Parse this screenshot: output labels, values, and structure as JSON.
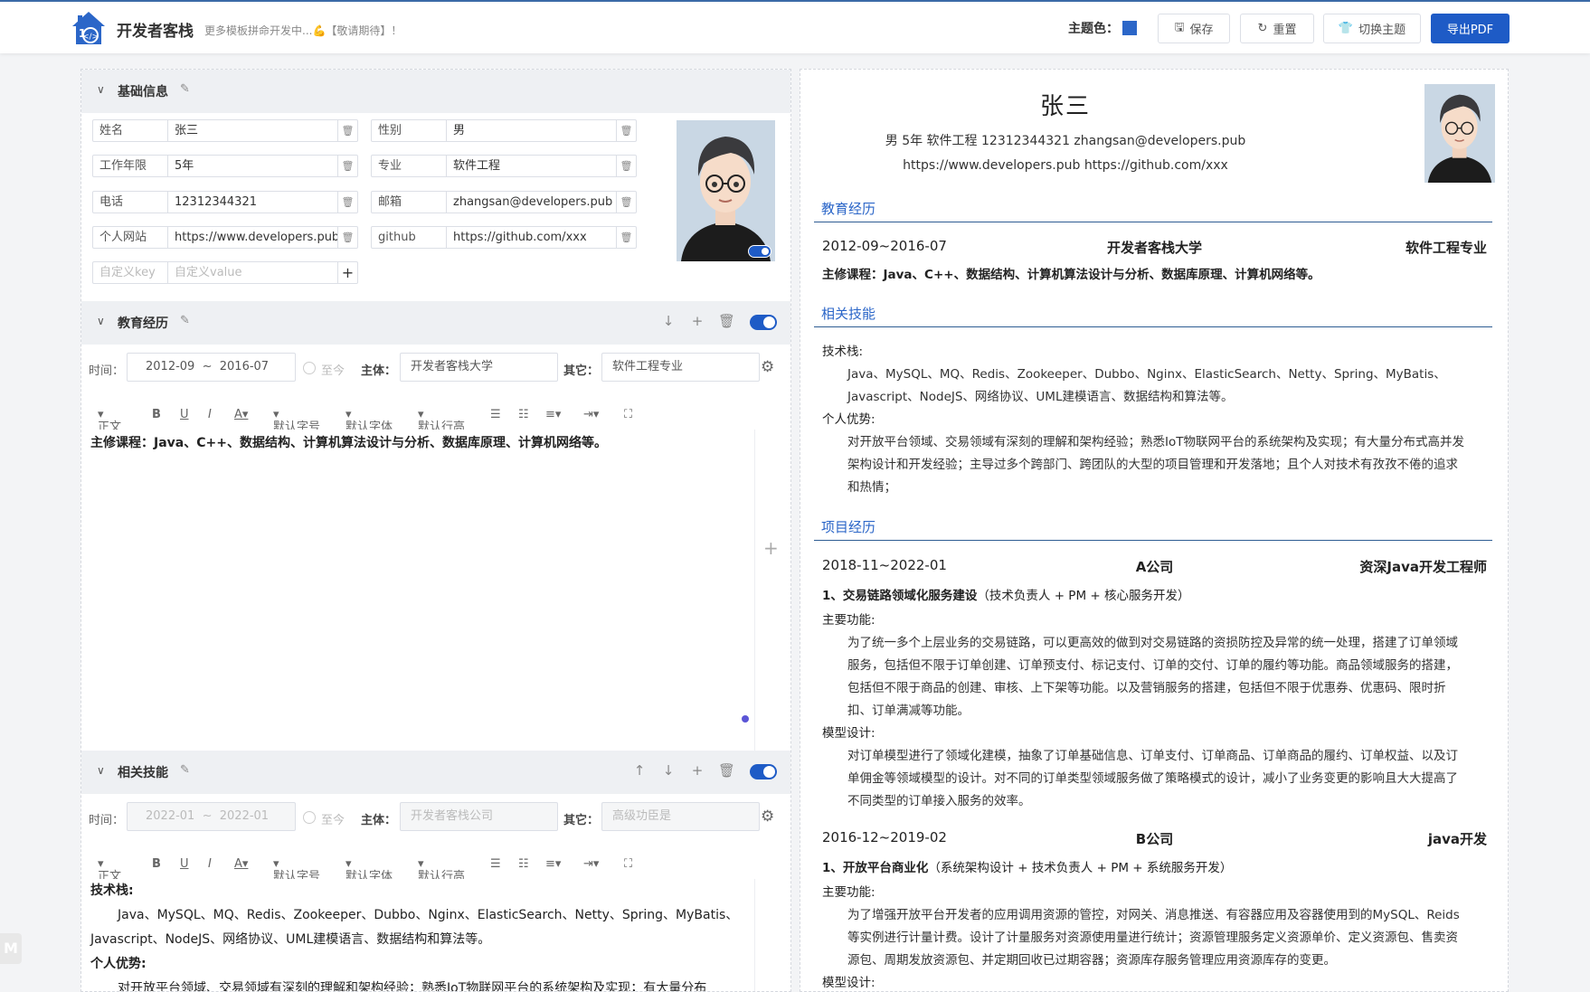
{
  "header": {
    "brand": "开发者客栈",
    "subtitle": "更多模板拼命开发中...💪【敬请期待】！",
    "theme_label": "主题色：",
    "theme_color": "#2b66c8",
    "buttons": {
      "save": "保存",
      "reset": "重置",
      "switch_theme": "切换主题",
      "export": "导出PDF"
    }
  },
  "basic": {
    "title": "基础信息",
    "fields": [
      {
        "key": "姓名",
        "value": "张三"
      },
      {
        "key": "性别",
        "value": "男"
      },
      {
        "key": "工作年限",
        "value": "5年"
      },
      {
        "key": "专业",
        "value": "软件工程"
      },
      {
        "key": "电话",
        "value": "12312344321"
      },
      {
        "key": "邮箱",
        "value": "zhangsan@developers.pub"
      },
      {
        "key": "个人网站",
        "value": "https://www.developers.pub"
      },
      {
        "key": "github",
        "value": "https://github.com/xxx"
      }
    ],
    "custom_key_placeholder": "自定义key",
    "custom_value_placeholder": "自定义value"
  },
  "education": {
    "title": "教育经历",
    "time_label": "时间：",
    "start": "2012-09",
    "sep": "~",
    "end": "2016-07",
    "until_now": "至今",
    "subject_label": "主体：",
    "subject": "开发者客栈大学",
    "other_label": "其它：",
    "other": "软件工程专业",
    "content_prefix": "主修课程：",
    "content": "Java、C++、数据结构、计算机算法设计与分析、数据库原理、计算机网络等。"
  },
  "skills": {
    "title": "相关技能",
    "time_label": "时间：",
    "start_ph": "2022-01",
    "sep": "~",
    "end_ph": "2022-01",
    "until_now": "至今",
    "subject_label": "主体：",
    "subject_ph": "开发者客栈公司",
    "other_label": "其它：",
    "other_ph": "高级功臣是",
    "stack_label": "技术栈:",
    "stack_line1": "Java、MySQL、MQ、Redis、Zookeeper、Dubbo、Nginx、ElasticSearch、Netty、Spring、MyBatis、",
    "stack_line2": "Javascript、NodeJS、网络协议、UML建模语言、数据结构和算法等。",
    "adv_label": "个人优势:",
    "adv_line1": "对开放平台领域、交易领域有深刻的理解和架构经验；熟悉IoT物联网平台的系统架构及实现；有大量分布"
  },
  "toolbar": {
    "style": "正文",
    "size": "默认字号",
    "font": "默认字体",
    "line": "默认行高"
  },
  "preview": {
    "name": "张三",
    "info_line1": "男  5年  软件工程  12312344321  zhangsan@developers.pub",
    "info_line2": "https://www.developers.pub  https://github.com/xxx",
    "edu_title": "教育经历",
    "edu_date": "2012-09~2016-07",
    "edu_school": "开发者客栈大学",
    "edu_major": "软件工程专业",
    "edu_course": "主修课程：Java、C++、数据结构、计算机算法设计与分析、数据库原理、计算机网络等。",
    "skill_title": "相关技能",
    "skill_stack_label": "技术栈:",
    "skill_stack_1": "Java、MySQL、MQ、Redis、Zookeeper、Dubbo、Nginx、ElasticSearch、Netty、Spring、MyBatis、",
    "skill_stack_2": "Javascript、NodeJS、网络协议、UML建模语言、数据结构和算法等。",
    "skill_adv_label": "个人优势:",
    "skill_adv_1": "对开放平台领域、交易领域有深刻的理解和架构经验；熟悉IoT物联网平台的系统架构及实现；有大量分布式高并发",
    "skill_adv_2": "架构设计和开发经验；主导过多个跨部门、跨团队的大型的项目管理和开发落地；且个人对技术有孜孜不倦的追求",
    "skill_adv_3": "和热情；",
    "proj_title": "项目经历",
    "proj_a_date": "2018-11~2022-01",
    "proj_a_company": "A公司",
    "proj_a_role": "资深Java开发工程师",
    "proj_a_name": "1、交易链路领域化服务建设",
    "proj_a_name_note": "（技术负责人 + PM + 核心服务开发）",
    "proj_a_func_label": "主要功能:",
    "proj_a_func_1": "为了统一多个上层业务的交易链路，可以更高效的做到对交易链路的资损防控及异常的统一处理，搭建了订单领域",
    "proj_a_func_2": "服务，包括但不限于订单创建、订单预支付、标记支付、订单的交付、订单的履约等功能。商品领域服务的搭建，",
    "proj_a_func_3": "包括但不限于商品的创建、审核、上下架等功能。以及营销服务的搭建，包括但不限于优惠券、优惠码、限时折",
    "proj_a_func_4": "扣、订单满减等功能。",
    "proj_a_model_label": "模型设计:",
    "proj_a_model_1": "对订单模型进行了领域化建模，抽象了订单基础信息、订单支付、订单商品、订单商品的履约、订单权益、以及订",
    "proj_a_model_2": "单佣金等领域模型的设计。对不同的订单类型领域服务做了策略模式的设计，减小了业务变更的影响且大大提高了",
    "proj_a_model_3": "不同类型的订单接入服务的效率。",
    "proj_b_date": "2016-12~2019-02",
    "proj_b_company": "B公司",
    "proj_b_role": "java开发",
    "proj_b_name": "1、开放平台商业化",
    "proj_b_name_note": "（系统架构设计 + 技术负责人 + PM + 系统服务开发）",
    "proj_b_func_label": "主要功能:",
    "proj_b_func_1": "为了增强开放平台开发者的应用调用资源的管控，对网关、消息推送、有容器应用及容器使用到的MySQL、Reids",
    "proj_b_func_2": "等实例进行计量计费。设计了计量服务对资源使用量进行统计；资源管理服务定义资源单价、定义资源包、售卖资",
    "proj_b_func_3": "源包、周期发放资源包、并定期回收已过期容器；资源库存服务管理应用资源库存的变更。",
    "proj_b_model_label": "模型设计:"
  },
  "badge": "M"
}
